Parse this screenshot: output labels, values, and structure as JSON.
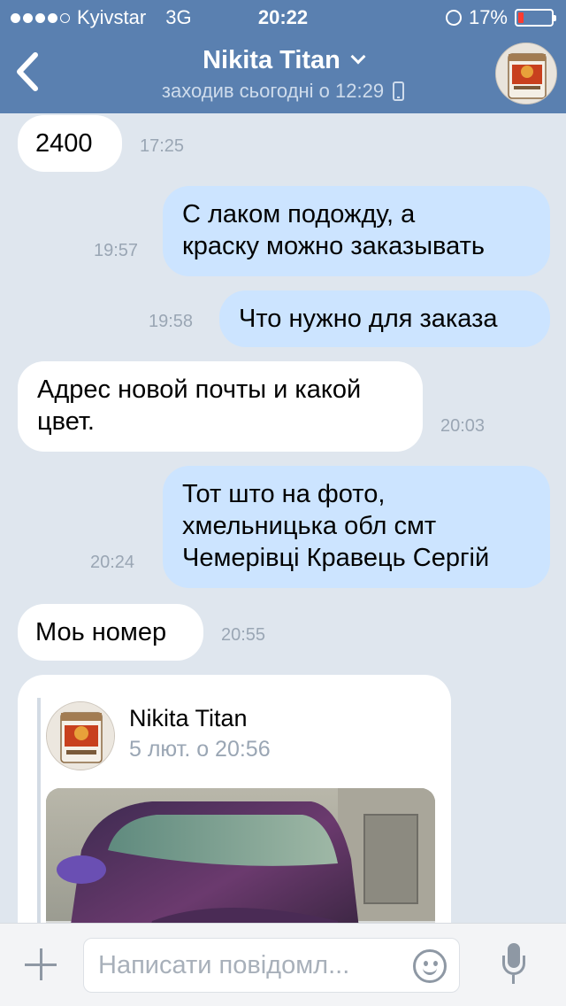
{
  "status_bar": {
    "carrier": "Kyivstar",
    "network": "3G",
    "time": "20:22",
    "battery": "17%",
    "battery_level": 0.17,
    "signal_bars_filled": 4,
    "signal_bars_total": 5
  },
  "header": {
    "name": "Nikita Titan",
    "last_seen": "заходив сьогодні о 12:29"
  },
  "messages": [
    {
      "direction": "in",
      "text": "2400",
      "time": "17:25"
    },
    {
      "direction": "out",
      "text_lines": [
        "С лаком подожду, а",
        "краску можно заказывать"
      ],
      "time": "19:57"
    },
    {
      "direction": "out",
      "text": "Что нужно для заказа",
      "time": "19:58"
    },
    {
      "direction": "in",
      "text_lines": [
        "Адрес новой почты и какой",
        "цвет."
      ],
      "time": "20:03"
    },
    {
      "direction": "out",
      "text_lines": [
        "Тот што на фото,",
        "хмельницька обл смт",
        "Чемерівці Кравець Сергій"
      ],
      "time": "20:24"
    },
    {
      "direction": "in",
      "text": "Моь номер",
      "time": "20:55"
    }
  ],
  "forwarded": {
    "author": "Nikita Titan",
    "date": "5 лют. о 20:56"
  },
  "input": {
    "placeholder": "Написати повідомл..."
  },
  "colors": {
    "header_bg": "#5a80b0",
    "chat_bg": "#dfe6ee",
    "bubble_in": "#ffffff",
    "bubble_out": "#cce4ff",
    "battery_low": "#ff3b30"
  }
}
